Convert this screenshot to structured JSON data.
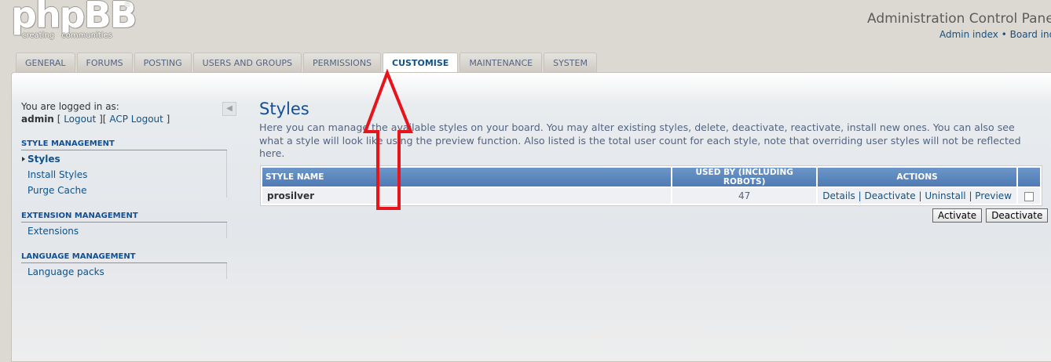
{
  "header": {
    "logo_text": "phpBB",
    "logo_reg": "®",
    "logo_tagline": "creating communities",
    "title": "Administration Control Panel",
    "links": [
      "Admin index",
      "Board index"
    ],
    "link_separator": "•"
  },
  "tabs": [
    {
      "label": "GENERAL",
      "active": false
    },
    {
      "label": "FORUMS",
      "active": false
    },
    {
      "label": "POSTING",
      "active": false
    },
    {
      "label": "USERS AND GROUPS",
      "active": false
    },
    {
      "label": "PERMISSIONS",
      "active": false
    },
    {
      "label": "CUSTOMISE",
      "active": true
    },
    {
      "label": "MAINTENANCE",
      "active": false
    },
    {
      "label": "SYSTEM",
      "active": false
    }
  ],
  "sidebar": {
    "logged_in_label": "You are logged in as:",
    "username": "admin",
    "logout_label": "Logout",
    "acp_logout_label": "ACP Logout",
    "sections": [
      {
        "title": "STYLE MANAGEMENT",
        "items": [
          {
            "label": "Styles",
            "active": true
          },
          {
            "label": "Install Styles",
            "active": false
          },
          {
            "label": "Purge Cache",
            "active": false
          }
        ]
      },
      {
        "title": "EXTENSION MANAGEMENT",
        "items": [
          {
            "label": "Extensions",
            "active": false
          }
        ]
      },
      {
        "title": "LANGUAGE MANAGEMENT",
        "items": [
          {
            "label": "Language packs",
            "active": false
          }
        ]
      }
    ]
  },
  "main": {
    "title": "Styles",
    "description": "Here you can manage the available styles on your board. You may alter existing styles, delete, deactivate, reactivate, install new ones. You can also see what a style will look like using the preview function. Also listed is the total user count for each style, note that overriding user styles will not be reflected here.",
    "table": {
      "headers": [
        "STYLE NAME",
        "USED BY (INCLUDING ROBOTS)",
        "ACTIONS"
      ],
      "rows": [
        {
          "name": "prosilver",
          "used_by": "47",
          "actions": [
            "Details",
            "Deactivate",
            "Uninstall",
            "Preview"
          ]
        }
      ]
    },
    "buttons": {
      "activate": "Activate",
      "deactivate": "Deactivate"
    }
  },
  "colors": {
    "accent": "#105289",
    "table_header": "#5f8ac0",
    "annotation_arrow": "#e8141b"
  }
}
